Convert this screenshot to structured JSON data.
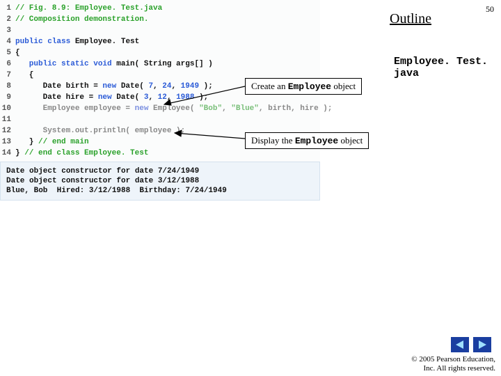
{
  "slide_number": "50",
  "outline_label": "Outline",
  "filename": "Employee. Test. java",
  "callout1_pre": "Create an ",
  "callout1_emp": "Employee",
  "callout1_post": " object",
  "callout2_pre": "Display the ",
  "callout2_emp": "Employee",
  "callout2_post": " object",
  "code": {
    "l1": "// Fig. 8.9: Employee. Test.java",
    "l2": "// Composition demonstration.",
    "l3": "",
    "l4a": "public class ",
    "l4b": "Employee. Test",
    "l5": "{",
    "l6a": "   public static void ",
    "l6b": "main( String args[] )",
    "l7": "   {",
    "l8a": "      Date birth = ",
    "l8b": "new ",
    "l8c": "Date( ",
    "l8d": "7",
    "l8e": ", ",
    "l8f": "24",
    "l8g": ", ",
    "l8h": "1949",
    "l8i": " );",
    "l9a": "      Date hire = ",
    "l9b": "new ",
    "l9c": "Date( ",
    "l9d": "3",
    "l9e": ", ",
    "l9f": "12",
    "l9g": ", ",
    "l9h": "1988",
    "l9i": " );",
    "l10a": "      Employee employee = ",
    "l10b": "new ",
    "l10c": "Employee( ",
    "l10d": "\"Bob\"",
    "l10e": ", ",
    "l10f": "\"Blue\"",
    "l10g": ", birth, hire );",
    "l11": "",
    "l12": "      System.out.println( employee );",
    "l13a": "   } ",
    "l13b": "// end main",
    "l14a": "} ",
    "l14b": "// end class Employee. Test"
  },
  "output": "Date object constructor for date 7/24/1949\nDate object constructor for date 3/12/1988\nBlue, Bob  Hired: 3/12/1988  Birthday: 7/24/1949",
  "copyright_line1": "© 2005 Pearson Education,",
  "copyright_line2": "Inc.  All rights reserved."
}
